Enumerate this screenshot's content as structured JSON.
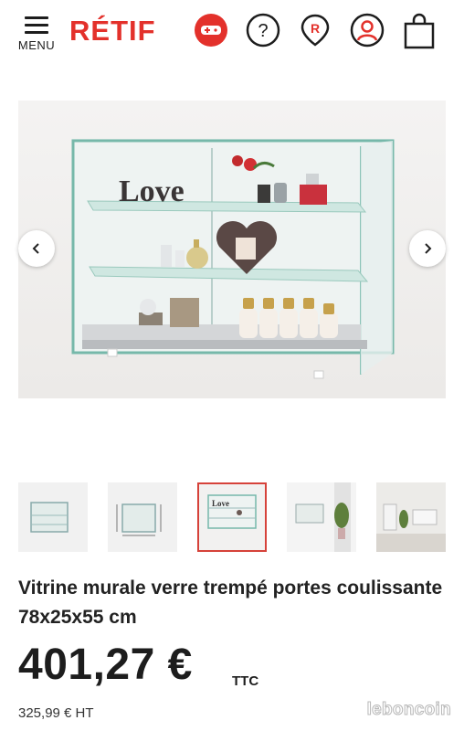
{
  "header": {
    "menu_label": "MENU",
    "logo_text": "RÉTIF",
    "icons": [
      "play-store-icon",
      "help-icon",
      "location-pin-icon",
      "account-icon",
      "cart-icon"
    ],
    "brand_color": "#e3312b"
  },
  "gallery": {
    "main_image_alt": "Vitrine murale verre trempé",
    "sign_text": "Love",
    "prev_icon": "chevron-left-icon",
    "next_icon": "chevron-right-icon",
    "thumbnail_count": 5,
    "active_thumbnail": 3
  },
  "product": {
    "title": "Vitrine murale verre trempé portes coulissante 78x25x55 cm",
    "price": "401,27 €",
    "price_suffix": "TTC",
    "price_ht": "325,99 € HT"
  },
  "watermark": "leboncoin"
}
